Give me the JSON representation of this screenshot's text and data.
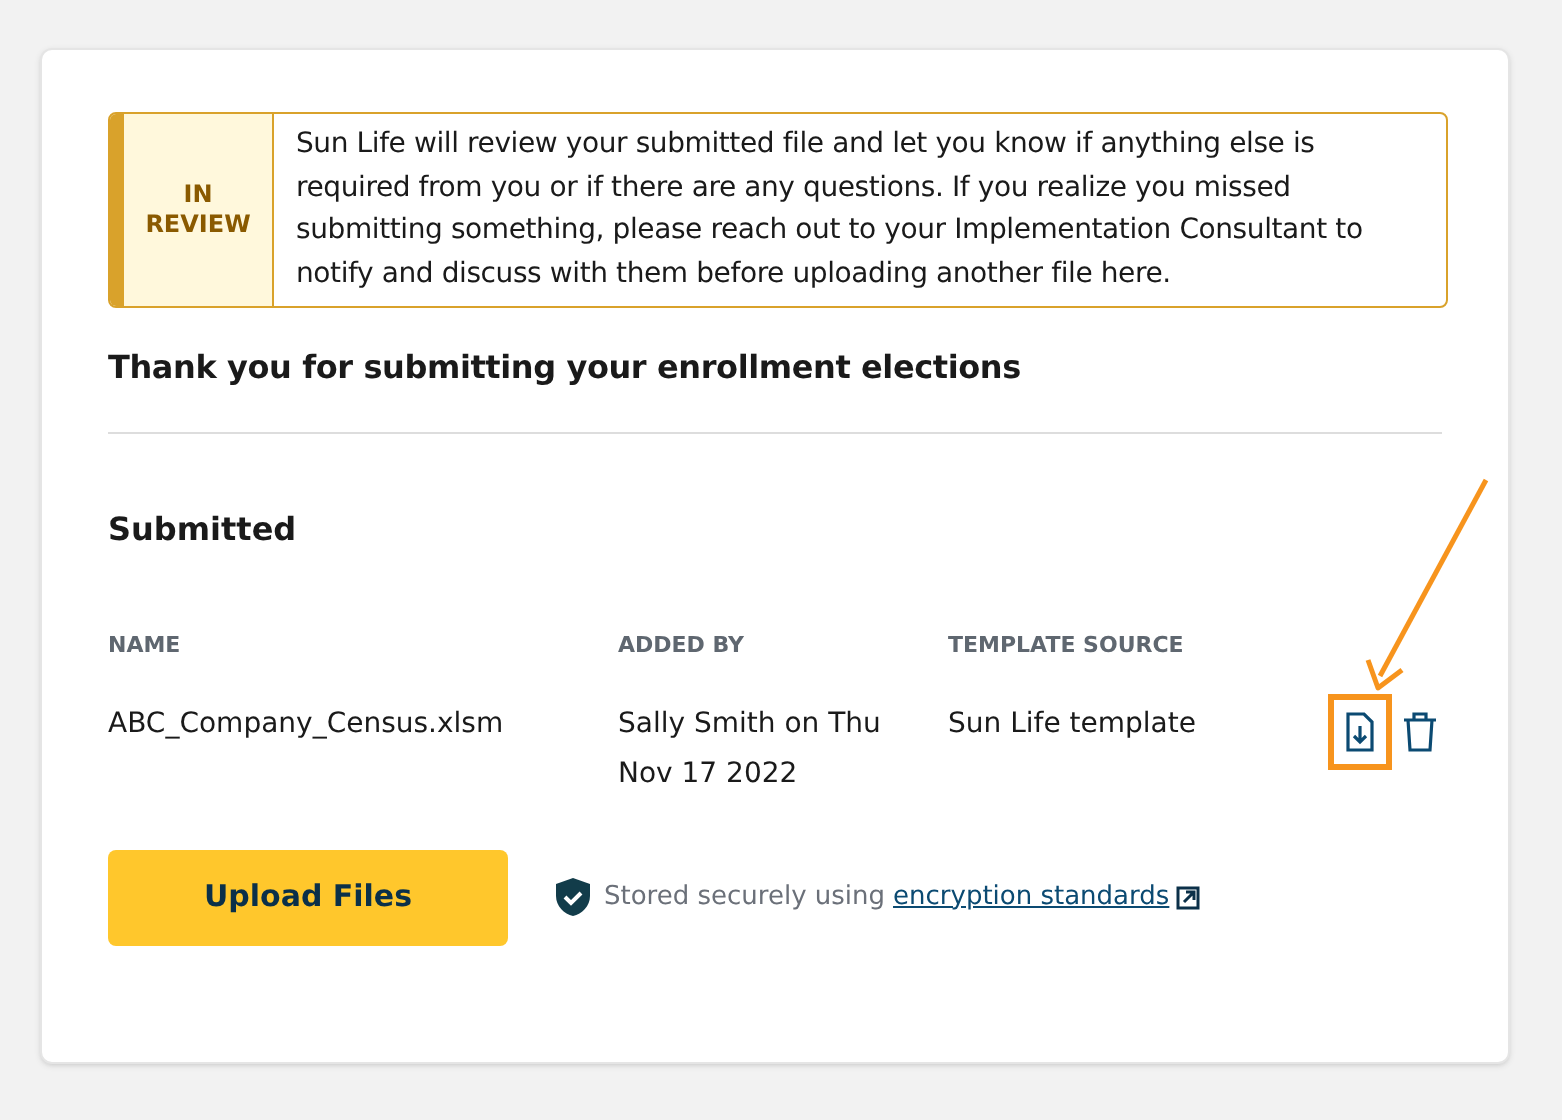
{
  "status_banner": {
    "label": "IN REVIEW",
    "message": "Sun Life will review your submitted file and let you know if anything else is required from you or if there are any questions. If you realize you missed submitting something, please reach out to your Implementation Consultant to notify and discuss with them before uploading another file here."
  },
  "heading": "Thank you for submitting your enrollment elections",
  "section_title": "Submitted",
  "table": {
    "columns": [
      "NAME",
      "ADDED BY",
      "TEMPLATE SOURCE"
    ],
    "rows": [
      {
        "cells": [
          "ABC_Company_Census.xlsm",
          "Sally Smith on Thu Nov 17 2022",
          "Sun Life template"
        ],
        "download_highlighted": true
      }
    ]
  },
  "upload_button": "Upload Files",
  "security_note": {
    "text": "Stored securely using",
    "link": "encryption standards"
  }
}
